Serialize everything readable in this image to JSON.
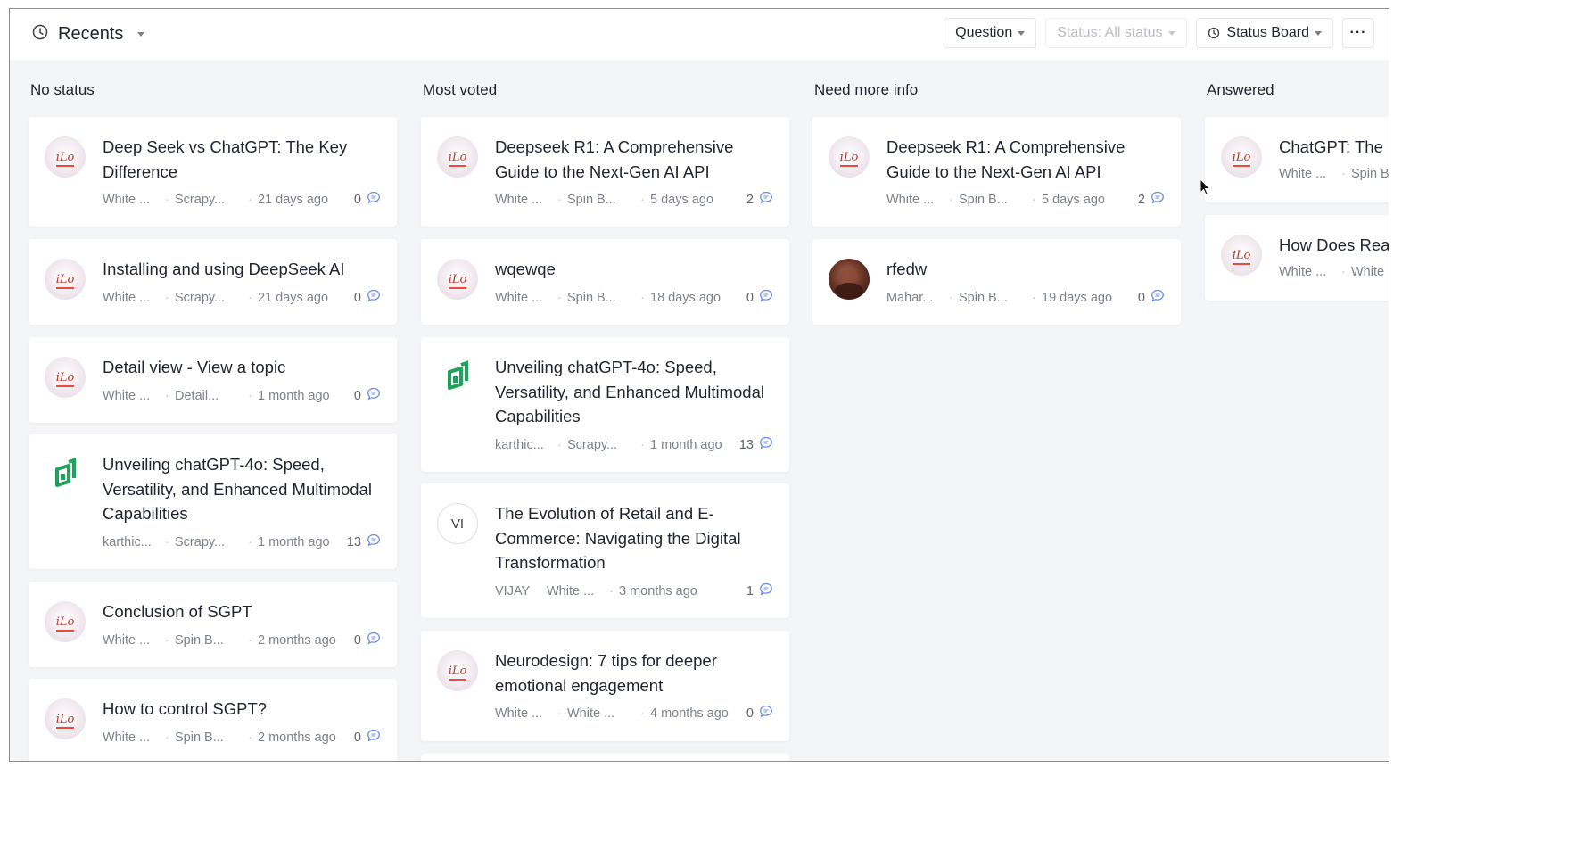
{
  "topbar": {
    "title": "Recents",
    "question_label": "Question",
    "status_filter_label": "Status: All status",
    "view_label": "Status Board",
    "more_label": "···"
  },
  "columns": [
    {
      "title": "No status",
      "cards": [
        {
          "title": "Deep Seek vs ChatGPT: The Key Difference",
          "author": "White ...",
          "category": "Scrapy...",
          "time": "21 days ago",
          "count": "0"
        },
        {
          "title": "Installing and using DeepSeek AI",
          "author": "White ...",
          "category": "Scrapy...",
          "time": "21 days ago",
          "count": "0"
        },
        {
          "title": "Detail view - View a topic",
          "author": "White ...",
          "category": "Detail...",
          "time": "1 month ago",
          "count": "0"
        },
        {
          "title": "Unveiling chatGPT-4o: Speed, Versatility, and Enhanced Multimodal Capabilities",
          "author": "karthic...",
          "category": "Scrapy...",
          "time": "1 month ago",
          "count": "13"
        },
        {
          "title": "Conclusion of SGPT",
          "author": "White ...",
          "category": "Spin B...",
          "time": "2 months ago",
          "count": "0"
        },
        {
          "title": "How to control SGPT?",
          "author": "White ...",
          "category": "Spin B...",
          "time": "2 months ago",
          "count": "0"
        }
      ]
    },
    {
      "title": "Most voted",
      "cards": [
        {
          "title": "Deepseek R1: A Comprehensive Guide to the Next-Gen AI API",
          "author": "White ...",
          "category": "Spin B...",
          "time": "5 days ago",
          "count": "2"
        },
        {
          "title": "wqewqe",
          "author": "White ...",
          "category": "Spin B...",
          "time": "18 days ago",
          "count": "0"
        },
        {
          "title": "Unveiling chatGPT-4o: Speed, Versatility, and Enhanced Multimodal Capabilities",
          "author": "karthic...",
          "category": "Scrapy...",
          "time": "1 month ago",
          "count": "13"
        },
        {
          "title": "The Evolution of Retail and E-Commerce: Navigating the Digital Transformation",
          "author": "VIJAY",
          "category": "White ...",
          "time": "3 months ago",
          "count": "1",
          "initials": "VI"
        },
        {
          "title": "Neurodesign: 7 tips for deeper emotional engagement",
          "author": "White ...",
          "category": "White ...",
          "time": "4 months ago",
          "count": "0"
        }
      ]
    },
    {
      "title": "Need more info",
      "cards": [
        {
          "title": "Deepseek R1: A Comprehensive Guide to the Next-Gen AI API",
          "author": "White ...",
          "category": "Spin B...",
          "time": "5 days ago",
          "count": "2"
        },
        {
          "title": "rfedw",
          "author": "Mahar...",
          "category": "Spin B...",
          "time": "19 days ago",
          "count": "0"
        }
      ]
    },
    {
      "title": "Answered",
      "cards": [
        {
          "title": "ChatGPT: The I",
          "author": "White ...",
          "category": "Spin B"
        },
        {
          "title": "How Does Rea",
          "author": "White ...",
          "category": "White"
        }
      ]
    }
  ],
  "colors": {
    "board_bg": "#f4f5f7",
    "card_bg": "#ffffff",
    "text": "#1f2430",
    "meta": "#7c828c",
    "comment_icon": "#6b8ef0",
    "green_logo": "#1fa35a"
  }
}
